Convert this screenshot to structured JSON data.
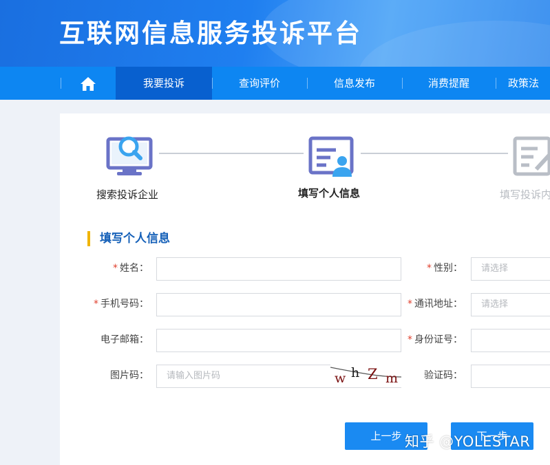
{
  "header": {
    "site_title": "互联网信息服务投诉平台"
  },
  "nav": {
    "items": [
      {
        "label": "我要投诉"
      },
      {
        "label": "查询评价"
      },
      {
        "label": "信息发布"
      },
      {
        "label": "消费提醒"
      },
      {
        "label": "政策法"
      }
    ]
  },
  "steps": [
    {
      "label": "搜索投诉企业"
    },
    {
      "label": "填写个人信息"
    },
    {
      "label": "填写投诉内"
    }
  ],
  "form": {
    "section_title": "填写个人信息",
    "required_mark": "*",
    "fields": {
      "name": {
        "label": "姓名："
      },
      "gender": {
        "label": "性别：",
        "placeholder": "请选择"
      },
      "phone": {
        "label": "手机号码："
      },
      "address": {
        "label": "通讯地址：",
        "placeholder": "请选择"
      },
      "email": {
        "label": "电子邮箱："
      },
      "id_number": {
        "label": "身份证号："
      },
      "image_code": {
        "label": "图片码：",
        "placeholder": "请输入图片码"
      },
      "verify_code": {
        "label": "验证码："
      }
    },
    "captcha_text": "whZm"
  },
  "buttons": {
    "prev": "上一步",
    "next": "下一步"
  },
  "watermark": "知乎 @YOLESTAR",
  "colors": {
    "nav": "#0d86f2",
    "nav_active": "#0860cf",
    "accent": "#f0b400",
    "section_title": "#1560b8",
    "required": "#e0402e"
  }
}
